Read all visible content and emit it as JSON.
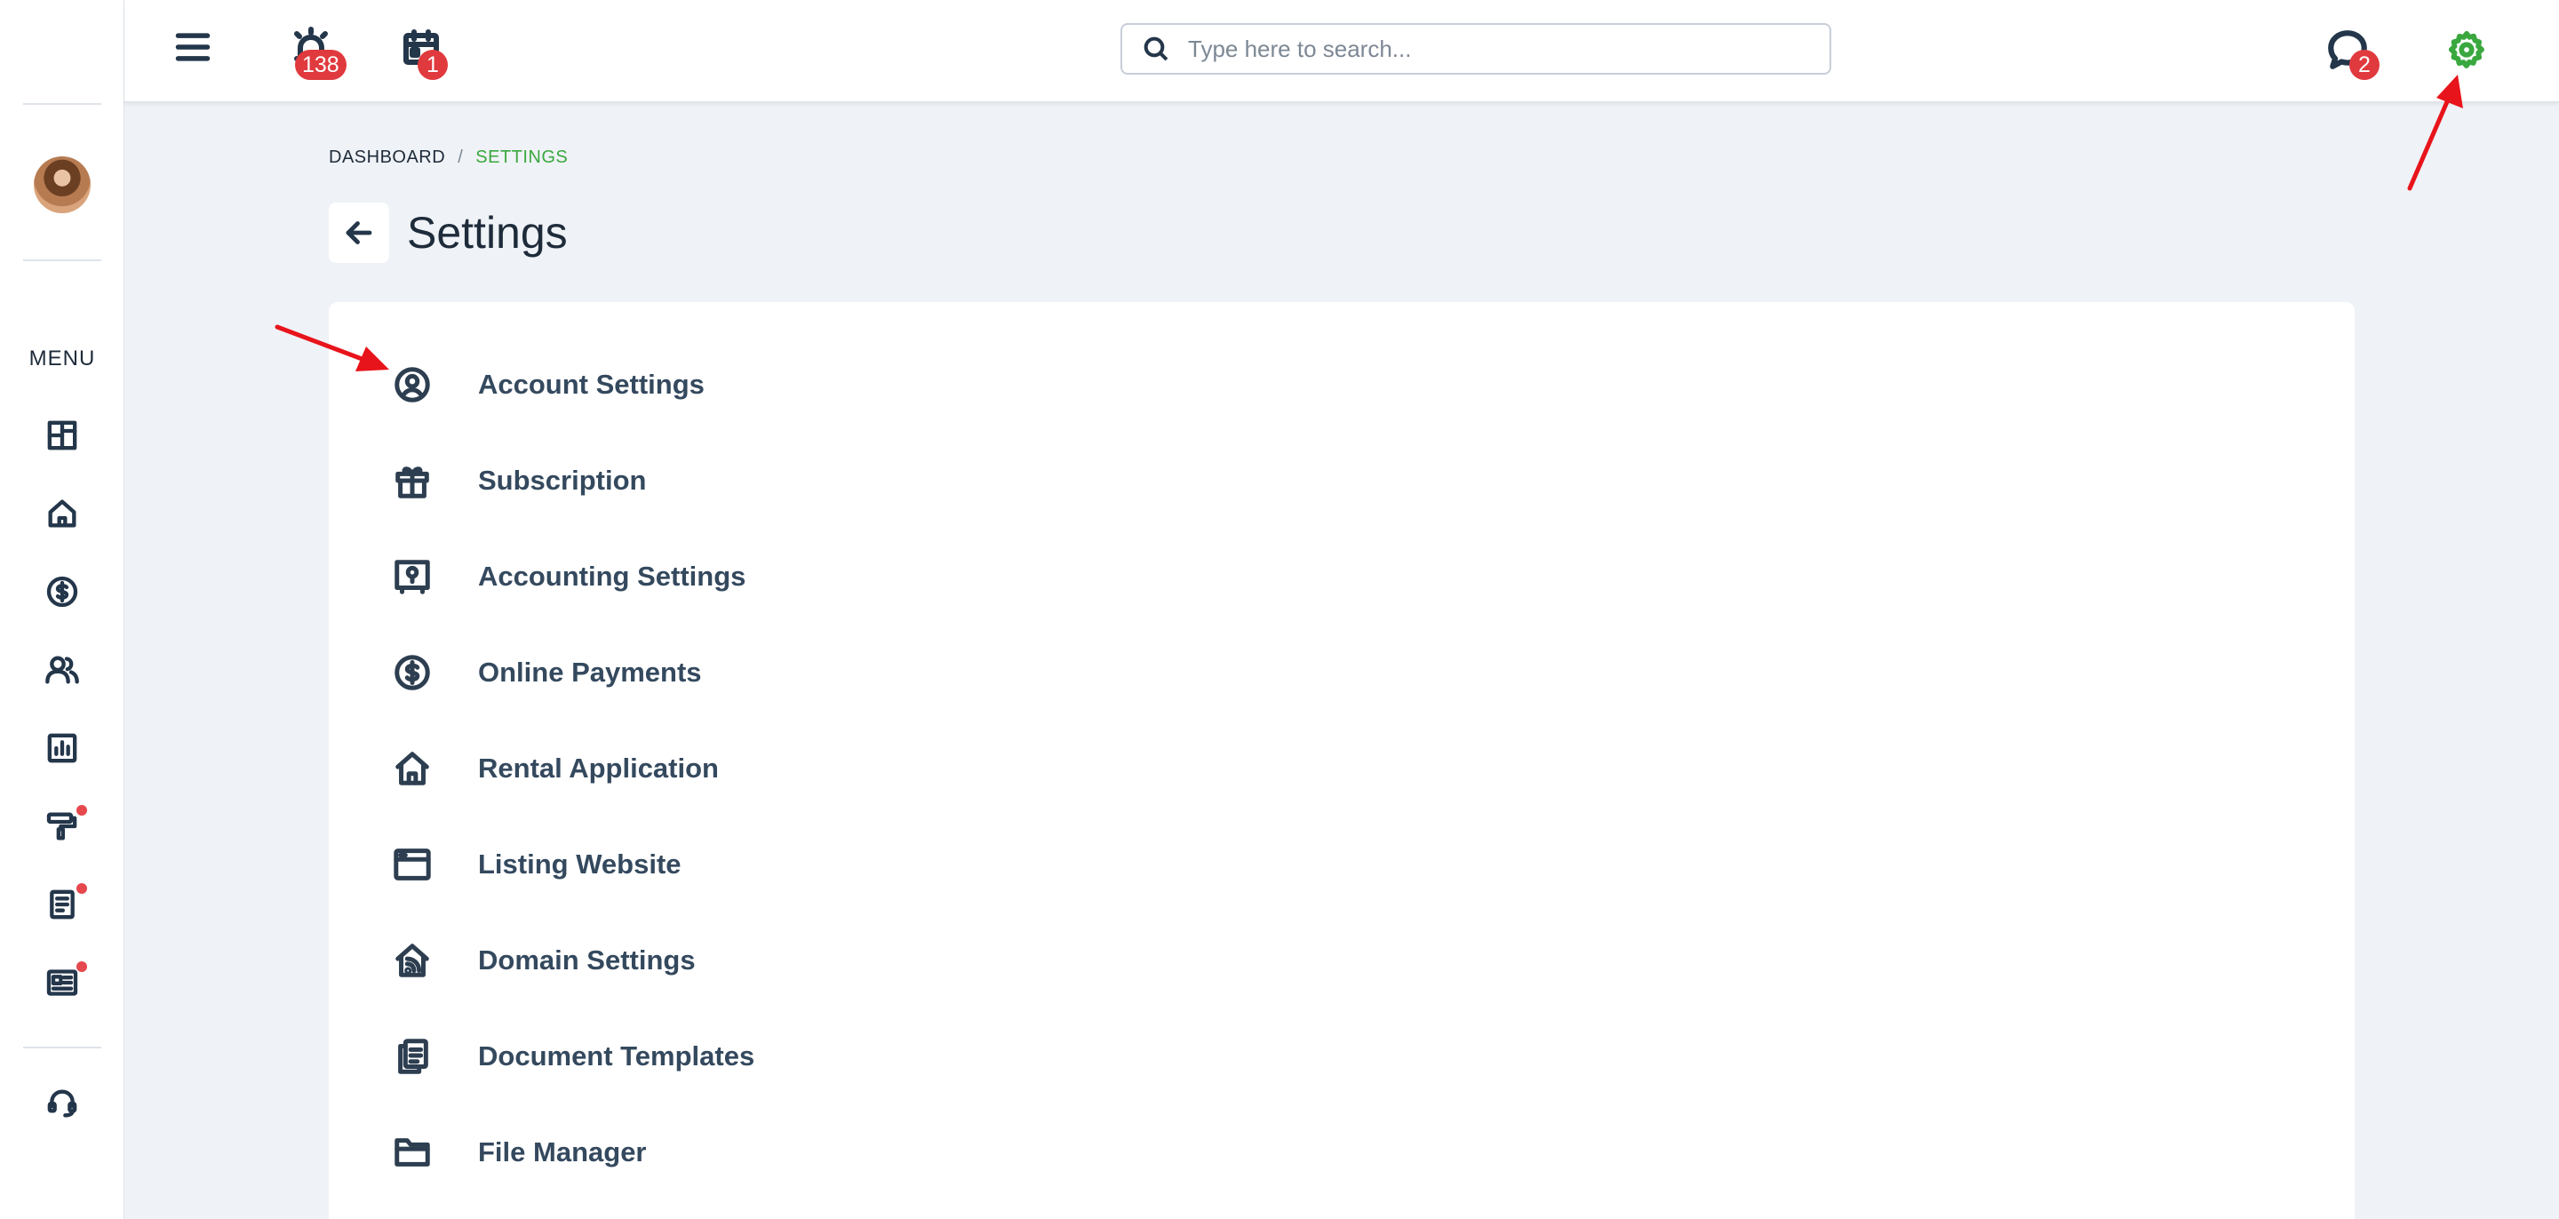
{
  "sidebar": {
    "menu_label": "MENU",
    "nav_icons": [
      "dashboard-icon",
      "home-icon",
      "dollar-icon",
      "users-icon",
      "report-icon",
      "maintenance-icon",
      "document-icon",
      "listing-icon"
    ],
    "support_icon": "headset-icon"
  },
  "topbar": {
    "alarm_badge": "138",
    "calendar_badge": "1",
    "chat_badge": "2",
    "search_placeholder": "Type here to search..."
  },
  "breadcrumb": {
    "root": "DASHBOARD",
    "separator": "/",
    "current": "SETTINGS"
  },
  "page": {
    "title": "Settings"
  },
  "settings": {
    "items": [
      {
        "label": "Account Settings",
        "icon": "user-circle-icon"
      },
      {
        "label": "Subscription",
        "icon": "gift-icon"
      },
      {
        "label": "Accounting Settings",
        "icon": "safe-icon"
      },
      {
        "label": "Online Payments",
        "icon": "dollar-circle-icon"
      },
      {
        "label": "Rental Application",
        "icon": "house-icon"
      },
      {
        "label": "Listing Website",
        "icon": "browser-icon"
      },
      {
        "label": "Domain Settings",
        "icon": "house-signal-icon"
      },
      {
        "label": "Document Templates",
        "icon": "documents-icon"
      },
      {
        "label": "File Manager",
        "icon": "folder-icon"
      }
    ]
  },
  "colors": {
    "accent_green": "#3aa83f",
    "badge_red": "#e03a3e",
    "annotation_arrow": "#e8141b"
  }
}
